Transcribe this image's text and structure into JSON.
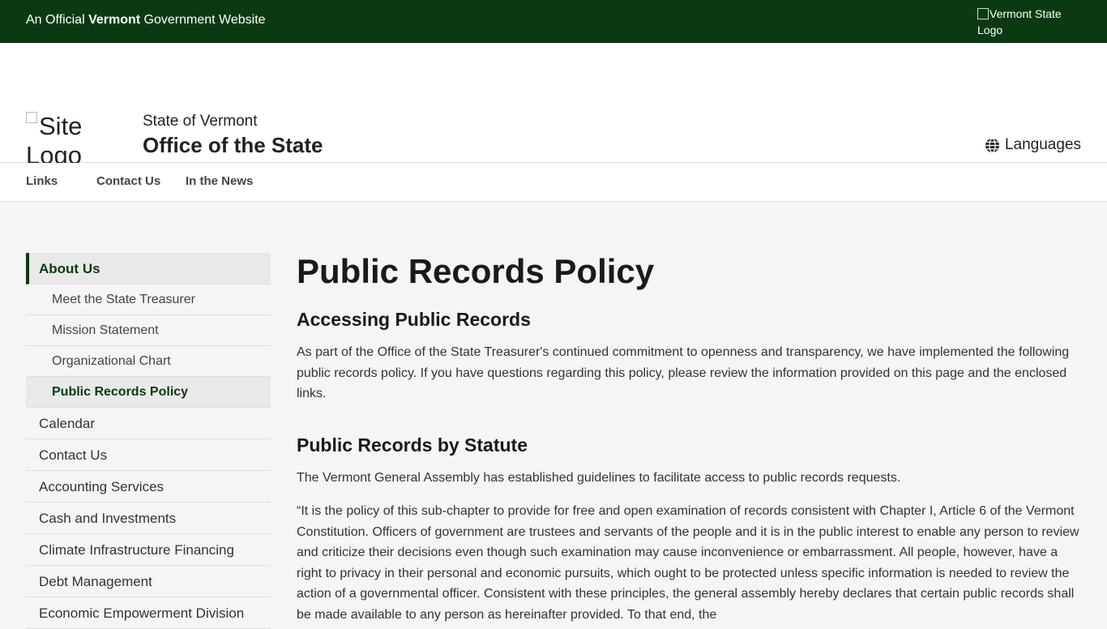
{
  "topbar": {
    "official_prefix": "An Official ",
    "official_state": "Vermont",
    "official_suffix": " Government Website",
    "state_logo_alt": "Vermont State Logo"
  },
  "header": {
    "site_logo_alt": "Site Logo",
    "kicker": "State of Vermont",
    "site_name": "Office of the State Treasurer",
    "languages_label": "Languages",
    "search_placeholder": ""
  },
  "nav": {
    "items": [
      {
        "label": "Links"
      },
      {
        "label": "Contact Us"
      },
      {
        "label": "In the News"
      }
    ]
  },
  "sidebar": {
    "section": "About Us",
    "sub_items": [
      {
        "label": "Meet the State Treasurer"
      },
      {
        "label": "Mission Statement"
      },
      {
        "label": "Organizational Chart"
      },
      {
        "label": "Public Records Policy"
      }
    ],
    "items": [
      {
        "label": "Calendar"
      },
      {
        "label": "Contact Us"
      },
      {
        "label": "Accounting Services"
      },
      {
        "label": "Cash and Investments"
      },
      {
        "label": "Climate Infrastructure Financing"
      },
      {
        "label": "Debt Management"
      },
      {
        "label": "Economic Empowerment Division"
      }
    ]
  },
  "content": {
    "title": "Public Records Policy",
    "h2_1": "Accessing Public Records",
    "p1": "As part of the Office of the State Treasurer's continued commitment to openness and transparency, we have implemented the following public records policy. If you have questions regarding this policy, please review the information provided on this page and the enclosed links.",
    "h2_2": "Public Records by Statute",
    "p2": "The Vermont General Assembly has established guidelines to facilitate access to public records requests.",
    "p3": "“It is the policy of this sub-chapter to provide for free and open examination of records consistent with Chapter I, Article 6 of the Vermont Constitution. Officers of government are trustees and servants of the people and it is in the public interest to enable any person to review and criticize their decisions even though such examination may cause inconvenience or embarrassment. All people, however, have a right to privacy in their personal and economic pursuits, which ought to be protected unless specific information is needed to review the action of a governmental officer. Consistent with these principles, the general assembly hereby declares that certain public records shall be made available to any person as hereinafter provided. To that end, the"
  },
  "colors": {
    "brand_green": "#0b3a12",
    "page_bg": "#f5f5f5"
  }
}
